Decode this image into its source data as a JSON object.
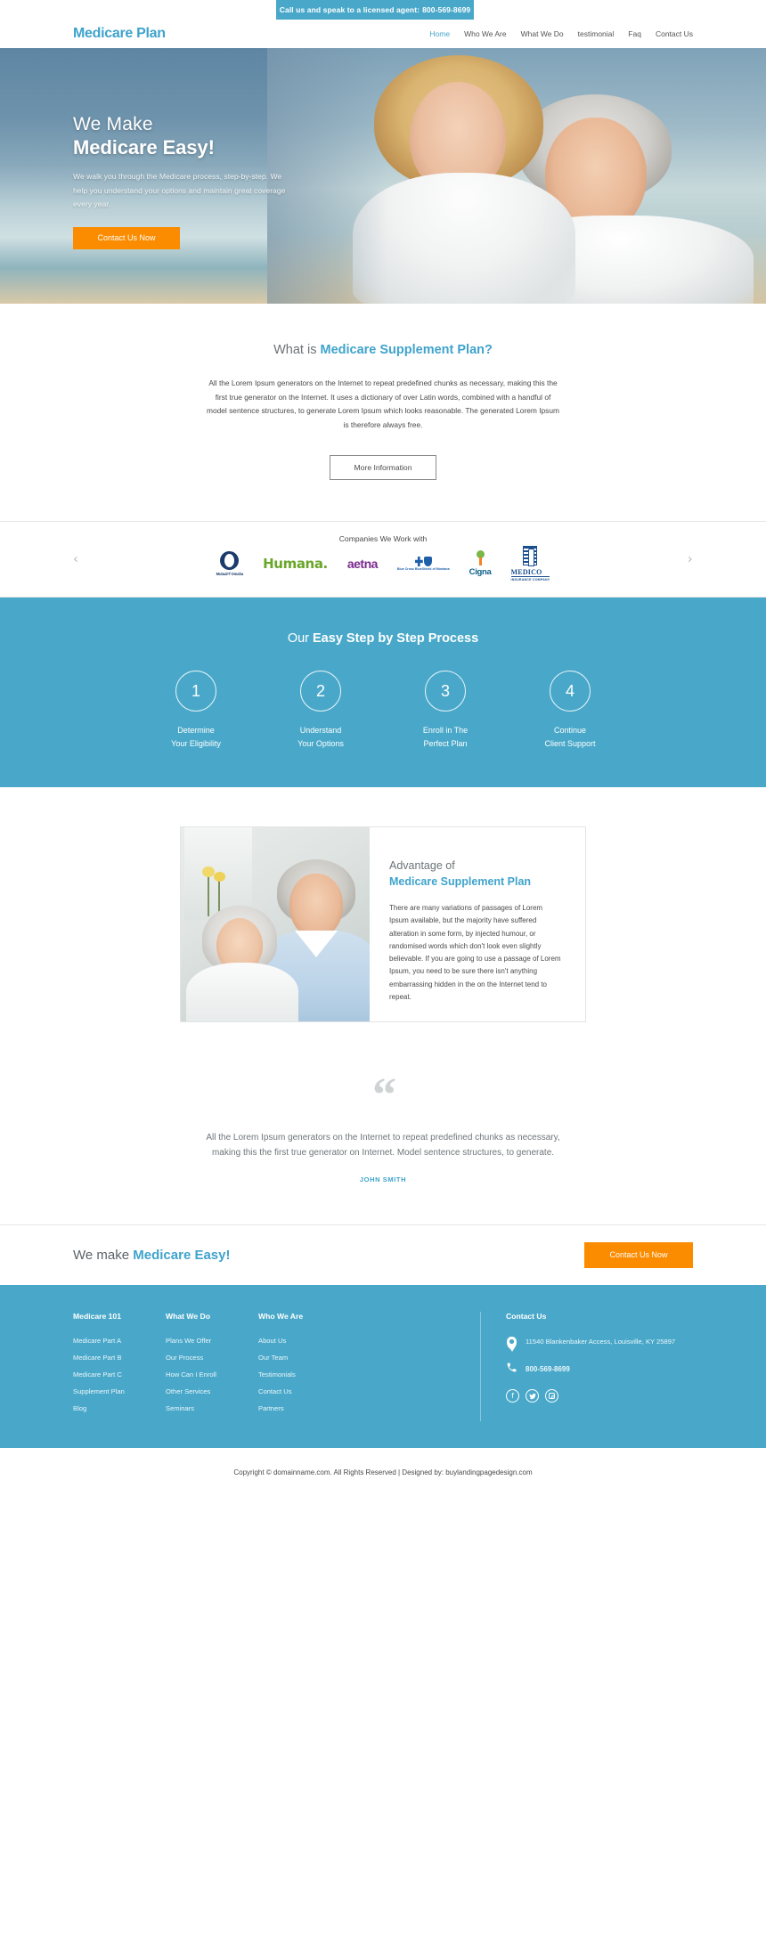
{
  "topbar": {
    "text": "Call us and speak to a licensed agent:",
    "phone": "800-569-8699"
  },
  "header": {
    "logo": "Medicare Plan",
    "nav": [
      {
        "label": "Home",
        "active": true
      },
      {
        "label": "Who We Are",
        "active": false
      },
      {
        "label": "What We Do",
        "active": false
      },
      {
        "label": "testimonial",
        "active": false
      },
      {
        "label": "Faq",
        "active": false
      },
      {
        "label": "Contact Us",
        "active": false
      }
    ]
  },
  "hero": {
    "line1": "We Make",
    "line2": "Medicare Easy!",
    "subtext": "We walk you through the Medicare process, step-by-step. We help you understand your options and maintain great coverage every year.",
    "cta_label": "Contact Us Now"
  },
  "whatis": {
    "title_plain": "What is ",
    "title_bold": "Medicare Supplement Plan?",
    "body": "All the Lorem Ipsum generators on the Internet to repeat predefined chunks as necessary, making this the first true generator on the Internet. It uses a dictionary of over Latin words, combined with a handful of model sentence structures, to generate Lorem Ipsum which looks reasonable. The generated Lorem Ipsum is therefore always free.",
    "button": "More Information"
  },
  "partners": {
    "title": "Companies We Work with",
    "prev": "‹",
    "next": "›",
    "logos": [
      {
        "name": "Mutual of Omaha",
        "short": "Mutualᵒf Omaha"
      },
      {
        "name": "Humana",
        "short": "Humana."
      },
      {
        "name": "aetna",
        "short": "aetna"
      },
      {
        "name": "Blue Cross Blue Shield of Montana",
        "short": "Blue Cross BlueShield of Montana"
      },
      {
        "name": "Cigna",
        "short": "Cigna"
      },
      {
        "name": "Medico Insurance Company",
        "short": "MEDICO",
        "sub": "INSURANCE COMPANY"
      }
    ]
  },
  "steps": {
    "title_plain": "Our ",
    "title_bold": "Easy Step by Step Process",
    "items": [
      {
        "num": "1",
        "line1": "Determine",
        "line2": "Your Eligibility"
      },
      {
        "num": "2",
        "line1": "Understand",
        "line2": "Your Options"
      },
      {
        "num": "3",
        "line1": "Enroll in The",
        "line2": "Perfect Plan"
      },
      {
        "num": "4",
        "line1": "Continue",
        "line2": "Client Support"
      }
    ]
  },
  "advantage": {
    "title_plain": "Advantage of",
    "title_bold": "Medicare Supplement Plan",
    "body": "There are many variations of passages of Lorem Ipsum available, but the majority have suffered alteration in some form, by injected humour, or randomised words which don't look even slightly believable. If you are going to use a passage of Lorem Ipsum, you need to be sure there isn't anything embarrassing hidden in the on the Internet tend to repeat."
  },
  "testimonial": {
    "quote_icon": "“",
    "text": "All the Lorem Ipsum generators on the Internet to repeat predefined chunks as necessary, making this the first true generator on Internet. Model sentence structures, to generate.",
    "author": "JOHN SMITH"
  },
  "cta": {
    "title_plain": "We make ",
    "title_bold": "Medicare Easy!",
    "button": "Contact Us Now"
  },
  "footer": {
    "columns": [
      {
        "heading": "Medicare 101",
        "links": [
          "Medicare Part A",
          "Medicare Part B",
          "Medicare Part C",
          "Supplement Plan",
          "Blog"
        ]
      },
      {
        "heading": "What We Do",
        "links": [
          "Plans We Offer",
          "Our Process",
          "How Can I Enroll",
          "Other Services",
          "Seminars"
        ]
      },
      {
        "heading": "Who We Are",
        "links": [
          "About Us",
          "Our Team",
          "Testimonials",
          "Contact Us",
          "Partners"
        ]
      }
    ],
    "contact": {
      "heading": "Contact Us",
      "address": "11540 Blankenbaker Access, Louisville, KY 25897",
      "phone": "800-569-8699",
      "socials": [
        "facebook",
        "twitter",
        "instagram"
      ]
    }
  },
  "copyright": {
    "text": "Copyright © domainname.com. All Rights Reserved | Designed by: buylandingpagedesign.com"
  },
  "colors": {
    "brand": "#49a8c9",
    "brand_text": "#3fa3cc",
    "accent": "#fb8c00"
  }
}
